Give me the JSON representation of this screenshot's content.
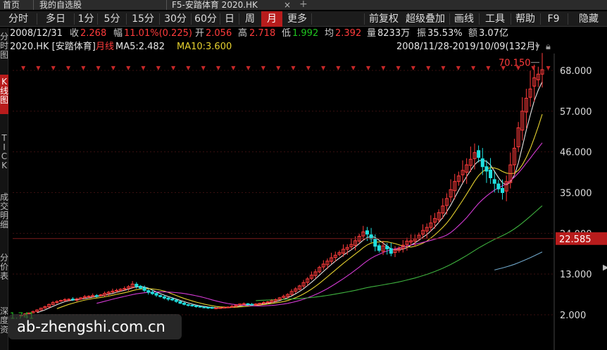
{
  "tab_bar": {
    "home": "首页",
    "watchlist": "我的自选股",
    "active_tab": "F5-安踏体育 2020.HK"
  },
  "toolbar": {
    "periods": [
      "分时",
      "多日",
      "1分",
      "5分",
      "15分",
      "30分",
      "60分",
      "日",
      "周",
      "月",
      "更多"
    ],
    "active_period": "月",
    "right": [
      "前复权",
      "超级叠加",
      "画线",
      "工具",
      "帮助",
      "F9",
      "隐藏"
    ]
  },
  "info": {
    "date": "2008/12/31",
    "close_label": "收",
    "close": "2.268",
    "change_label": "幅",
    "change": "11.01%(0.225)",
    "open_label": "开",
    "open": "2.056",
    "high_label": "高",
    "high": "2.718",
    "low_label": "低",
    "low": "1.992",
    "avg_label": "均",
    "avg": "2.392",
    "volume_label": "量",
    "volume": "8233万",
    "amplitude_label": "振",
    "amplitude": "35.53%",
    "amount_label": "额",
    "amount": "3.07亿"
  },
  "legend": {
    "symbol": "2020.HK [安踏体育]",
    "period": "月线",
    "ma5": "MA5:2.482",
    "ma10": "MA10:3.600",
    "range": "2008/11/28-2019/10/09(132月)"
  },
  "sidebar": [
    "分时图",
    "K线图",
    "TICK",
    "成交明细",
    "分价表",
    "深度资"
  ],
  "sidebar_active": 1,
  "markers": {
    "high": "70.150",
    "low": "1.741",
    "current_price": "22.585"
  },
  "colors": {
    "up": "#ff3b3b",
    "down": "#20e0e0",
    "ma5": "#e6e6e6",
    "ma10": "#e6d12f",
    "ma20": "#d33ad3",
    "ma60": "#3fb33f",
    "ma120": "#6fa6c9",
    "price_label_bg": "#b81c1c"
  },
  "watermark": "ab-zhengshi.com.cn",
  "chart_data": {
    "type": "candlestick",
    "title": "2020.HK [安踏体育] 月线",
    "y_ticks": [
      2.0,
      13.0,
      24.0,
      35.0,
      46.0,
      57.0,
      68.0
    ],
    "y_tick_labels": [
      "2.000",
      "13.000",
      "24.000",
      "35.000",
      "46.000",
      "57.000",
      "68.000"
    ],
    "ylim": [
      0,
      72
    ],
    "x_range": "2008/11/28-2019/10/09",
    "months": 132,
    "closes": [
      1.9,
      2.27,
      2.5,
      2.9,
      3.3,
      3.8,
      4.2,
      4.8,
      5.3,
      5.6,
      5.9,
      6.1,
      6.2,
      6.0,
      6.3,
      6.6,
      6.9,
      7.0,
      7.2,
      7.1,
      7.4,
      7.8,
      8.1,
      8.4,
      8.6,
      8.9,
      9.1,
      9.6,
      10.3,
      9.7,
      9.2,
      8.6,
      8.1,
      7.7,
      7.3,
      6.9,
      6.5,
      6.2,
      6.0,
      5.6,
      5.1,
      4.8,
      4.6,
      4.4,
      4.2,
      4.1,
      4.0,
      3.9,
      3.8,
      3.8,
      3.9,
      4.0,
      4.1,
      4.3,
      4.6,
      4.9,
      5.0,
      4.8,
      4.7,
      4.9,
      5.1,
      5.3,
      5.5,
      5.8,
      6.1,
      6.6,
      7.0,
      7.5,
      8.3,
      9.0,
      9.8,
      10.7,
      11.7,
      12.7,
      13.6,
      14.8,
      15.7,
      16.5,
      17.4,
      18.1,
      18.8,
      19.7,
      20.2,
      21.0,
      22.0,
      23.2,
      24.4,
      23.8,
      22.5,
      20.5,
      19.4,
      20.6,
      19.8,
      18.6,
      19.5,
      19.9,
      20.8,
      21.9,
      22.0,
      22.5,
      23.5,
      24.8,
      25.6,
      26.8,
      28.0,
      29.6,
      31.4,
      33.4,
      35.8,
      38.0,
      39.5,
      41.0,
      42.5,
      44.0,
      45.8,
      44.5,
      42.0,
      40.8,
      39.0,
      37.5,
      36.0,
      35.0,
      38.0,
      42.5,
      47.0,
      52.5,
      57.0,
      60.5,
      63.0,
      66.0,
      67.0,
      68.2
    ],
    "markers": {
      "high": 70.15,
      "low": 1.741,
      "current": 22.585
    }
  }
}
